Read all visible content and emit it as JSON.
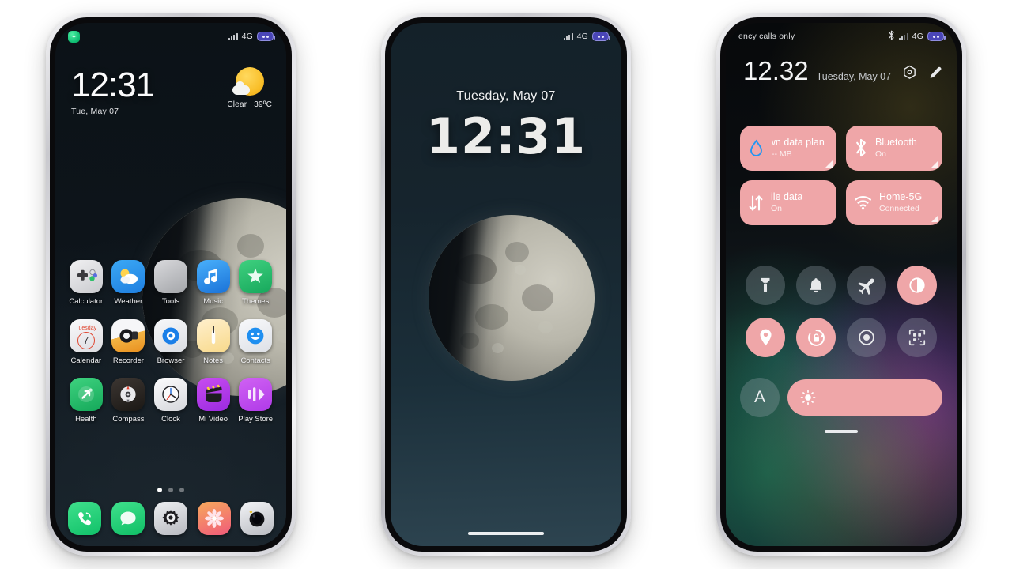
{
  "scene": {
    "device_count": 3,
    "background_color": "#ffffff"
  },
  "phone_home": {
    "status_bar": {
      "notification_badge_icon": "green-app-badge-icon",
      "signal_icon": "signal-bars-icon",
      "network": "4G",
      "battery_icon": "battery-icon"
    },
    "clock_widget": {
      "time": "12:31",
      "date": "Tue, May 07"
    },
    "weather_widget": {
      "icon": "sun-behind-cloud-icon",
      "condition": "Clear",
      "temperature": "39ºC"
    },
    "apps": [
      {
        "label": "Calculator",
        "icon": "calculator-icon"
      },
      {
        "label": "Weather",
        "icon": "weather-icon"
      },
      {
        "label": "Tools",
        "icon": "tools-folder-icon"
      },
      {
        "label": "Music",
        "icon": "music-icon"
      },
      {
        "label": "Themes",
        "icon": "themes-icon"
      },
      {
        "label": "Calendar",
        "icon": "calendar-icon",
        "day_name": "Tuesday",
        "day_number": "7"
      },
      {
        "label": "Recorder",
        "icon": "recorder-icon"
      },
      {
        "label": "Browser",
        "icon": "browser-icon"
      },
      {
        "label": "Notes",
        "icon": "notes-icon"
      },
      {
        "label": "Contacts",
        "icon": "contacts-icon"
      },
      {
        "label": "Health",
        "icon": "health-icon"
      },
      {
        "label": "Compass",
        "icon": "compass-icon"
      },
      {
        "label": "Clock",
        "icon": "clock-icon"
      },
      {
        "label": "Mi Video",
        "icon": "mi-video-icon"
      },
      {
        "label": "Play Store",
        "icon": "play-store-icon"
      }
    ],
    "page_dots": {
      "count": 3,
      "active_index": 0
    },
    "dock": [
      {
        "icon": "phone-icon"
      },
      {
        "icon": "messages-icon"
      },
      {
        "icon": "settings-icon"
      },
      {
        "icon": "gallery-icon"
      },
      {
        "icon": "camera-icon"
      }
    ],
    "wallpaper": "half-moon-wallpaper"
  },
  "phone_lock": {
    "status_bar": {
      "signal_icon": "signal-bars-icon",
      "network": "4G",
      "battery_icon": "battery-icon"
    },
    "date": "Tuesday, May 07",
    "time": "12:31",
    "wallpaper": "half-moon-wallpaper",
    "home_indicator": "home-indicator"
  },
  "phone_control_center": {
    "status_bar": {
      "carrier_text": "ency calls only",
      "bluetooth_icon": "bluetooth-icon",
      "signal_icon": "signal-bars-no-sim-icon",
      "network": "4G",
      "battery_icon": "battery-icon"
    },
    "header": {
      "time": "12.32",
      "date": "Tuesday, May 07",
      "settings_icon": "settings-gear-icon",
      "edit_icon": "edit-pencil-icon"
    },
    "cards": [
      {
        "icon": "data-usage-drop-icon",
        "title": "nown data plan",
        "subtitle": "-- MB",
        "active": true,
        "overflow": true
      },
      {
        "icon": "bluetooth-icon",
        "title": "Bluetooth",
        "subtitle": "On",
        "active": true,
        "overflow": false
      },
      {
        "icon": "mobile-data-arrows-icon",
        "title": "ile data",
        "subtitle": "On",
        "active": true,
        "overflow": false
      },
      {
        "icon": "wifi-icon",
        "title": "Home-5G",
        "subtitle": "Connected",
        "active": true,
        "overflow": false
      }
    ],
    "toggles": [
      {
        "icon": "flashlight-icon",
        "active": false
      },
      {
        "icon": "notification-bell-icon",
        "active": false
      },
      {
        "icon": "airplane-mode-icon",
        "active": false
      },
      {
        "icon": "dark-mode-icon",
        "active": true
      },
      {
        "icon": "location-pin-icon",
        "active": true
      },
      {
        "icon": "rotation-lock-icon",
        "active": true
      },
      {
        "icon": "screen-record-icon",
        "active": false
      },
      {
        "icon": "qr-scanner-icon",
        "active": false
      }
    ],
    "brightness": {
      "auto_label": "A",
      "slider_icon": "brightness-sun-icon",
      "fill_percent": 100
    },
    "grab_handle": "drag-handle"
  },
  "colors": {
    "accent_pink": "#efa6a8",
    "battery_purple": "#4a46b8",
    "home_bg": "#0d141a",
    "lock_bg": "#16242d"
  }
}
